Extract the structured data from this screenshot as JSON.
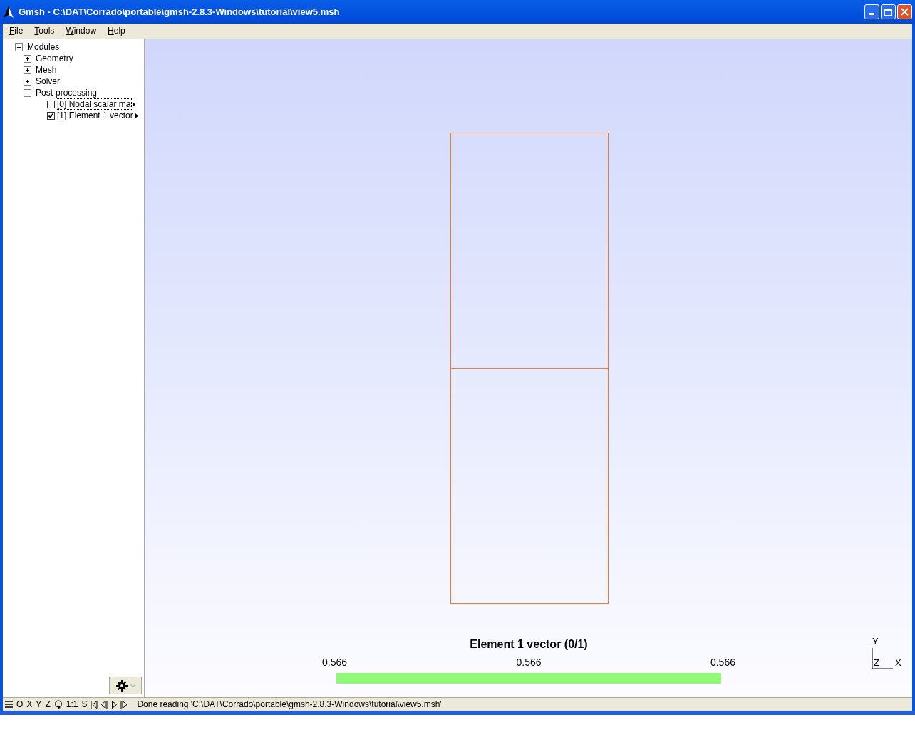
{
  "window": {
    "title": "Gmsh - C:\\DAT\\Corrado\\portable\\gmsh-2.8.3-Windows\\tutorial\\view5.msh"
  },
  "menu": [
    "File",
    "Tools",
    "Window",
    "Help"
  ],
  "tree": {
    "label": "Modules",
    "expanded": true,
    "children": [
      {
        "label": "Geometry",
        "expanded": false
      },
      {
        "label": "Mesh",
        "expanded": false
      },
      {
        "label": "Solver",
        "expanded": false
      },
      {
        "label": "Post-processing",
        "expanded": true,
        "children": [
          {
            "label": "[0] Nodal scalar ma",
            "checked": false,
            "selected": true
          },
          {
            "label": "[1] Element 1 vector",
            "checked": true,
            "selected": false
          }
        ]
      }
    ]
  },
  "scale": {
    "title": "Element 1 vector (0/1)",
    "labels": [
      "0.566",
      "0.566",
      "0.566"
    ],
    "color": "#90fa78"
  },
  "axes": {
    "y": "Y",
    "z": "Z",
    "x": "X"
  },
  "status_bar": {
    "buttons": [
      "O",
      "X",
      "Y",
      "Z",
      "1:1",
      "S"
    ],
    "message": "Done reading 'C:\\DAT\\Corrado\\portable\\gmsh-2.8.3-Windows\\tutorial\\view5.msh'"
  }
}
